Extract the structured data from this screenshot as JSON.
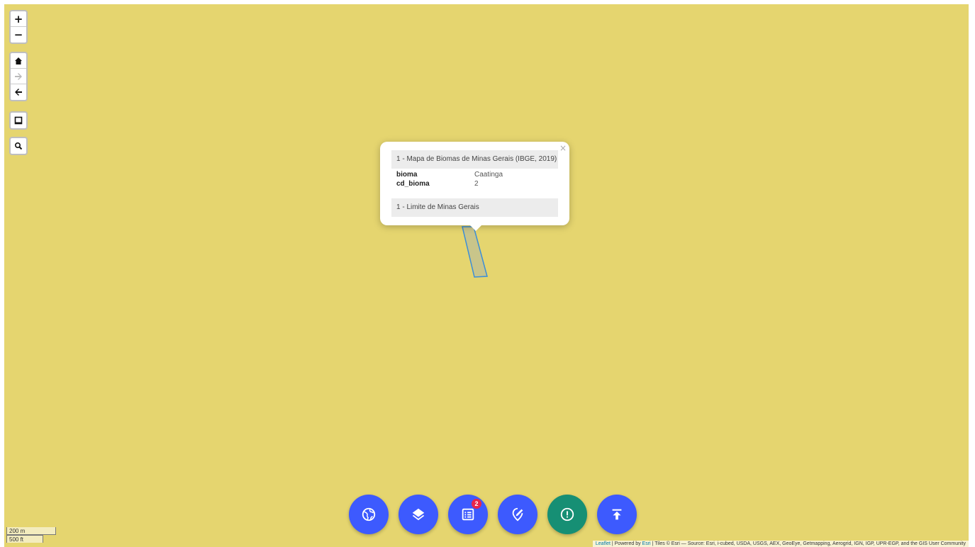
{
  "controls": {
    "zoom_in": "+",
    "zoom_out": "−"
  },
  "popup": {
    "close": "×",
    "header": "1 - Mapa de Biomas de Minas Gerais (IBGE, 2019)",
    "rows": [
      {
        "key": "bioma",
        "value": "Caatinga"
      },
      {
        "key": "cd_bioma",
        "value": "2"
      }
    ],
    "footer": "1 - Limite de Minas Gerais"
  },
  "fabs": [
    {
      "icon": "globe-icon",
      "color": "#3d5afe"
    },
    {
      "icon": "layers-icon",
      "color": "#3d5afe"
    },
    {
      "icon": "list-icon",
      "color": "#3d5afe",
      "badge": "2"
    },
    {
      "icon": "edit-location-icon",
      "color": "#3d5afe"
    },
    {
      "icon": "alert-circle-icon",
      "color": "#168f74"
    },
    {
      "icon": "upload-icon",
      "color": "#3d5afe"
    }
  ],
  "scale": {
    "metric": "200 m",
    "imperial": "500 ft"
  },
  "attribution": {
    "leaflet": "Leaflet",
    "sep1": " | Powered by ",
    "esri": "Esri",
    "text": " | Tiles © Esri — Source: Esri, i-cubed, USDA, USGS, AEX, GeoEye, Getmapping, Aerogrid, IGN, IGP, UPR-EGP, and the GIS User Community"
  },
  "colors": {
    "map_bg": "#e5d56f",
    "polygon_fill": "#c9c58a",
    "polygon_stroke": "#3b8ed8"
  }
}
